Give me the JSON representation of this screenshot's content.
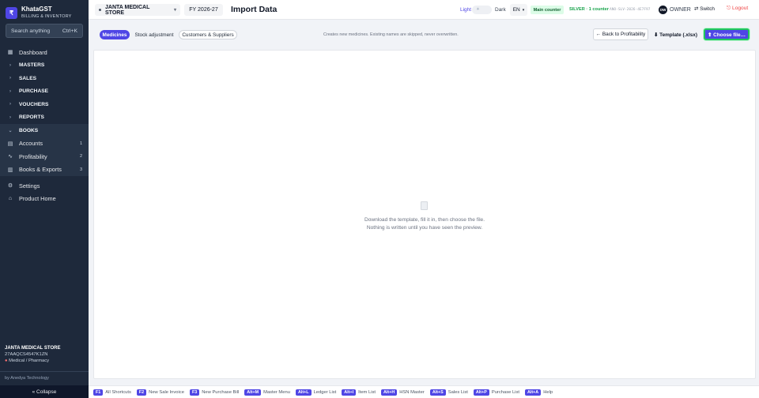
{
  "brand": {
    "logo": "₹",
    "name": "KhataGST",
    "subtitle": "BILLING & INVENTORY"
  },
  "search": {
    "placeholder": "Search anything",
    "shortcut": "Ctrl+K"
  },
  "sidebar": {
    "dashboard": "Dashboard",
    "groups": [
      "MASTERS",
      "SALES",
      "PURCHASE",
      "VOUCHERS",
      "REPORTS"
    ],
    "books": "BOOKS",
    "books_items": [
      {
        "label": "Accounts",
        "count": "1"
      },
      {
        "label": "Profitability",
        "count": "2"
      },
      {
        "label": "Books & Exports",
        "count": "3"
      }
    ],
    "settings": "Settings",
    "product_home": "Product Home",
    "store_name": "JANTA MEDICAL STORE",
    "gstin": "27AAQCS4547K1ZN",
    "store_type": "Medical / Pharmacy",
    "by": "by Anedya Technology",
    "collapse": "« Collapse"
  },
  "topbar": {
    "store": "JANTA MEDICAL STORE",
    "fy": "FY 2026-27",
    "title": "Import Data",
    "light": "Light",
    "dark": "Dark",
    "lang": "EN",
    "main_counter": "Main counter",
    "plan": "SILVER · 1 counter",
    "plan_id": "ANO-SLV-2026-4E7F97",
    "owner_initials": "OW",
    "owner": "OWNER",
    "switch": "⇄ Switch",
    "logout": "⎋ Logout"
  },
  "toolbar": {
    "tabs": [
      "Medicines",
      "Stock adjustment",
      "Customers & Suppliers"
    ],
    "hint": "Creates new medicines. Existing names are skipped, never overwritten.",
    "back": "← Back to Profitability",
    "template": "⬇ Template (.xlsx)",
    "choose": "⬆ Choose file…"
  },
  "empty": {
    "line1": "Download the template, fill it in, then choose the file.",
    "line2": "Nothing is written until you have seen the preview."
  },
  "shortcuts": [
    {
      "key": "F1",
      "label": "All Shortcuts"
    },
    {
      "key": "F2",
      "label": "New Sale Invoice"
    },
    {
      "key": "F3",
      "label": "New Purchase Bill"
    },
    {
      "key": "Alt+M",
      "label": "Master Menu"
    },
    {
      "key": "Alt+L",
      "label": "Ledger List"
    },
    {
      "key": "Alt+I",
      "label": "Item List"
    },
    {
      "key": "Alt+H",
      "label": "HSN Master"
    },
    {
      "key": "Alt+S",
      "label": "Sales List"
    },
    {
      "key": "Alt+P",
      "label": "Purchase List"
    },
    {
      "key": "Alt+A",
      "label": "Help"
    }
  ],
  "colors": {
    "sidebar": "#1e293b",
    "accent": "#4f46e5",
    "success": "#22c55e",
    "danger": "#ef4444"
  }
}
